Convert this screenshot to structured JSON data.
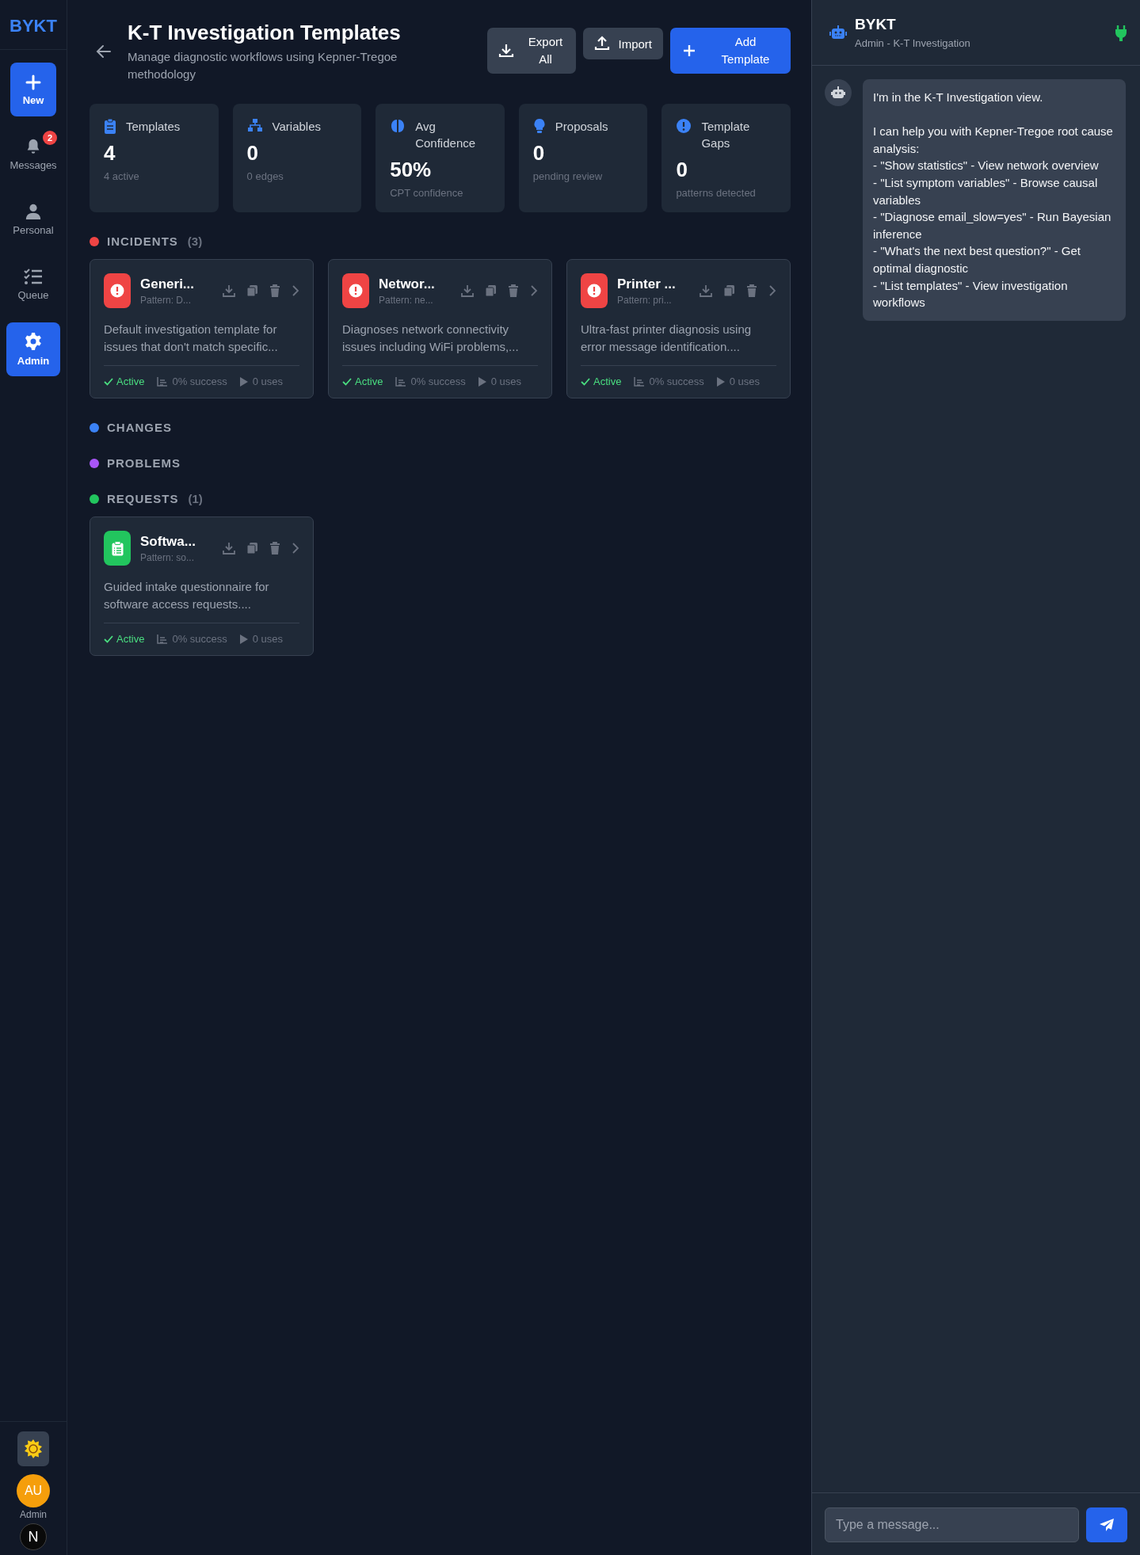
{
  "sidebar": {
    "logo": "BYKT",
    "items": [
      {
        "kind": "new",
        "label": "New",
        "selected": false
      },
      {
        "kind": "nav",
        "label": "Messages",
        "badge": "2",
        "selected": false
      },
      {
        "kind": "nav",
        "label": "Personal",
        "selected": false
      },
      {
        "kind": "nav",
        "label": "Queue",
        "selected": false
      },
      {
        "kind": "nav",
        "label": "Admin",
        "selected": true
      }
    ],
    "avatar": {
      "initials": "AU",
      "label": "Admin"
    },
    "overlay_badge": "N"
  },
  "header": {
    "title": "K-T Investigation Templates",
    "subtitle": "Manage diagnostic workflows using Kepner-Tregoe methodology",
    "buttons": [
      {
        "label": "Export All",
        "kind": "secondary"
      },
      {
        "label": "Import",
        "kind": "secondary"
      },
      {
        "label": "Add Template",
        "kind": "primary"
      }
    ]
  },
  "stats": [
    {
      "label": "Templates",
      "value": "4",
      "sub": "4 active"
    },
    {
      "label": "Variables",
      "value": "0",
      "sub": "0 edges"
    },
    {
      "label": "Avg Confidence",
      "value": "50%",
      "sub": "CPT confidence"
    },
    {
      "label": "Proposals",
      "value": "0",
      "sub": "pending review"
    },
    {
      "label": "Template Gaps",
      "value": "0",
      "sub": "patterns detected"
    }
  ],
  "groups": [
    {
      "label": "INCIDENTS",
      "count": "(3)",
      "color": "#ef4444",
      "templates": [
        {
          "title": "Generi...",
          "pattern": "Pattern: D...",
          "description": "Default investigation template for issues that don't match specific...",
          "status": "Active",
          "success": "0% success",
          "uses": "0 uses",
          "kind": "incident"
        },
        {
          "title": "Networ...",
          "pattern": "Pattern: ne...",
          "description": "Diagnoses network connectivity issues including WiFi problems,...",
          "status": "Active",
          "success": "0% success",
          "uses": "0 uses",
          "kind": "incident"
        },
        {
          "title": "Printer ...",
          "pattern": "Pattern: pri...",
          "description": "Ultra-fast printer diagnosis using error message identification....",
          "status": "Active",
          "success": "0% success",
          "uses": "0 uses",
          "kind": "incident"
        }
      ]
    },
    {
      "label": "CHANGES",
      "color": "#3b82f6"
    },
    {
      "label": "PROBLEMS",
      "color": "#a855f7"
    },
    {
      "label": "REQUESTS",
      "count": "(1)",
      "color": "#22c55e",
      "templates": [
        {
          "title": "Softwa...",
          "pattern": "Pattern: so...",
          "description": "Guided intake questionnaire for software access requests....",
          "status": "Active",
          "success": "0% success",
          "uses": "0 uses",
          "kind": "request"
        }
      ]
    }
  ],
  "chat": {
    "title": "BYKT",
    "subtitle": "Admin - K-T Investigation",
    "connected": true,
    "messages": [
      {
        "text": "I'm in the K-T Investigation view.\n\nI can help you with Kepner-Tregoe root cause analysis:\n- \"Show statistics\" - View network overview\n- \"List symptom variables\" - Browse causal variables\n- \"Diagnose email_slow=yes\" - Run Bayesian inference\n- \"What's the next best question?\" - Get optimal diagnostic\n- \"List templates\" - View investigation workflows"
      }
    ],
    "input": {
      "placeholder": "Type a message..."
    }
  }
}
